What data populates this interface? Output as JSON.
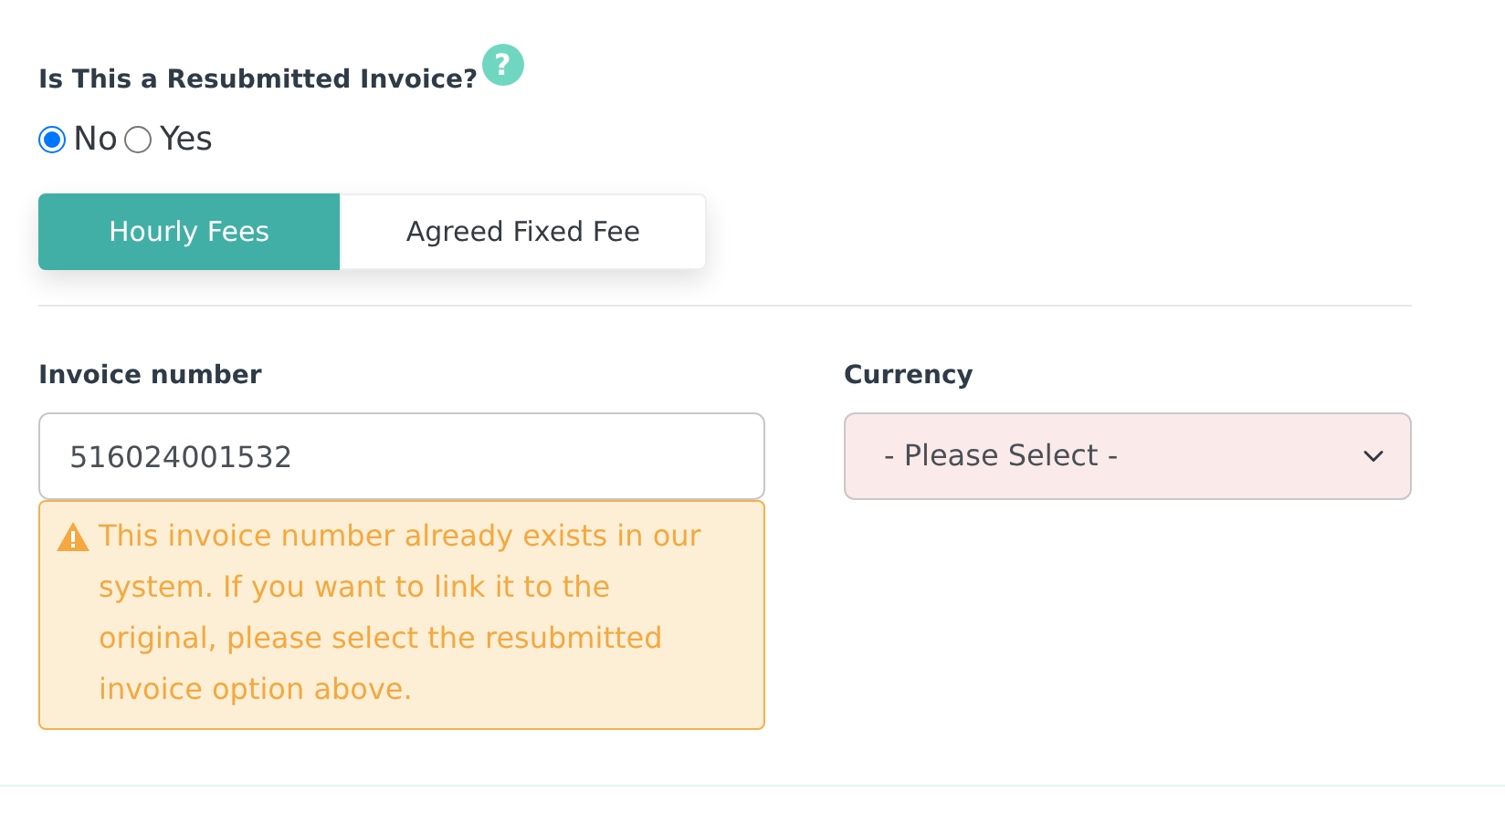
{
  "resubmitted": {
    "question": "Is This a Resubmitted Invoice?",
    "help_icon": "?",
    "options": [
      {
        "label": "No",
        "selected": true
      },
      {
        "label": "Yes",
        "selected": false
      }
    ]
  },
  "fee_tabs": [
    {
      "label": "Hourly Fees",
      "selected": true
    },
    {
      "label": "Agreed Fixed Fee",
      "selected": false
    }
  ],
  "invoice_number": {
    "label": "Invoice number",
    "value": "516024001532",
    "warning": "This invoice number already exists in our system. If you want to link it to the original, please select the resubmitted invoice option above."
  },
  "currency": {
    "label": "Currency",
    "value": "- Please Select -",
    "invalid": true
  }
}
